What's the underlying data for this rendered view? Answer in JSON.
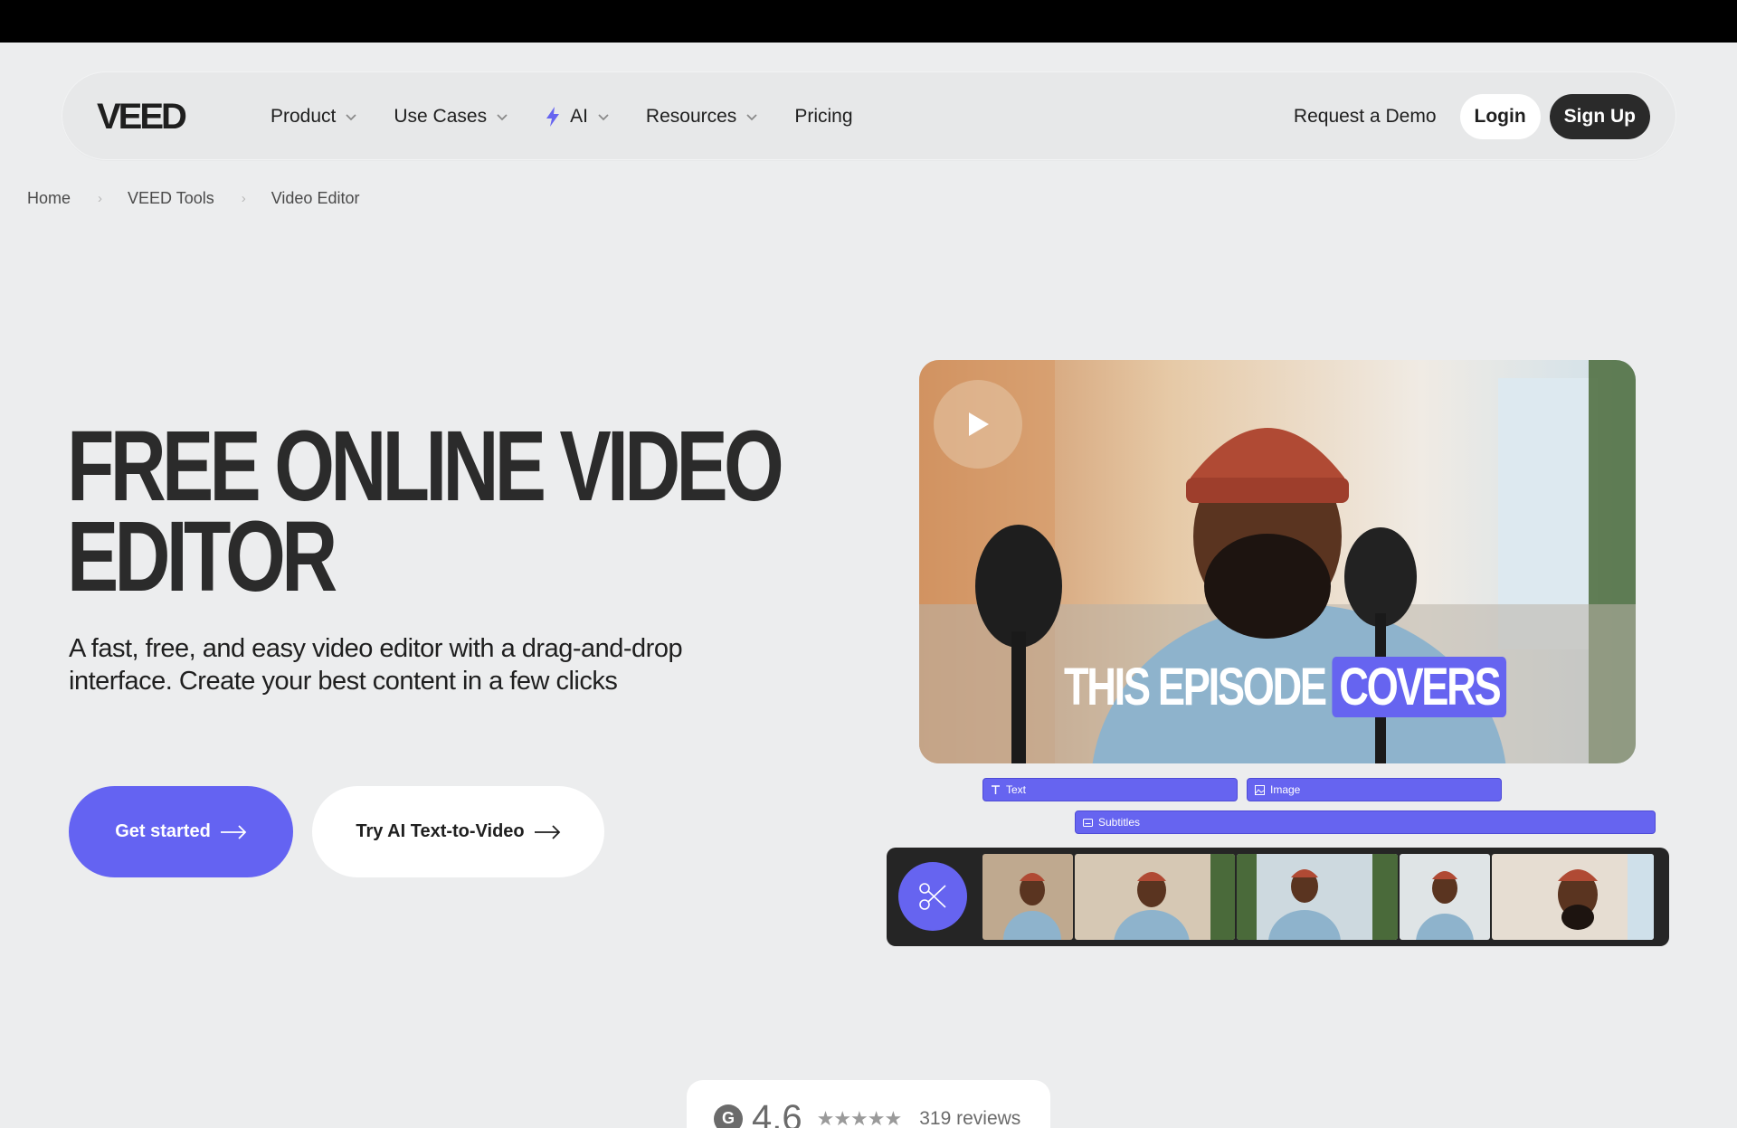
{
  "nav": {
    "logo_text": "VEED",
    "items": [
      {
        "label": "Product",
        "has_dropdown": true
      },
      {
        "label": "Use Cases",
        "has_dropdown": true
      },
      {
        "label": "AI",
        "has_dropdown": true,
        "icon": "lightning-bolt-icon"
      },
      {
        "label": "Resources",
        "has_dropdown": true
      },
      {
        "label": "Pricing",
        "has_dropdown": false
      }
    ],
    "request_demo": "Request a Demo",
    "login": "Login",
    "signup": "Sign Up"
  },
  "breadcrumb": [
    "Home",
    "VEED Tools",
    "Video Editor"
  ],
  "hero": {
    "title_line1": "FREE ONLINE VIDEO",
    "title_line2": "EDITOR",
    "subtitle": "A fast, free, and easy video editor with a drag-and-drop interface. Create your best content in a few clicks",
    "primary_cta": "Get started",
    "secondary_cta": "Try AI Text-to-Video"
  },
  "preview": {
    "caption_plain": "THIS EPISODE",
    "caption_highlight": "COVERS",
    "tracks": {
      "text": "Text",
      "image": "Image",
      "subtitles": "Subtitles"
    }
  },
  "rating": {
    "score": "4.6",
    "reviews": "319 reviews",
    "stars": "★★★★★"
  },
  "colors": {
    "accent": "#6664f0",
    "background": "#ecedee",
    "dark_button": "#2a2a2a"
  }
}
